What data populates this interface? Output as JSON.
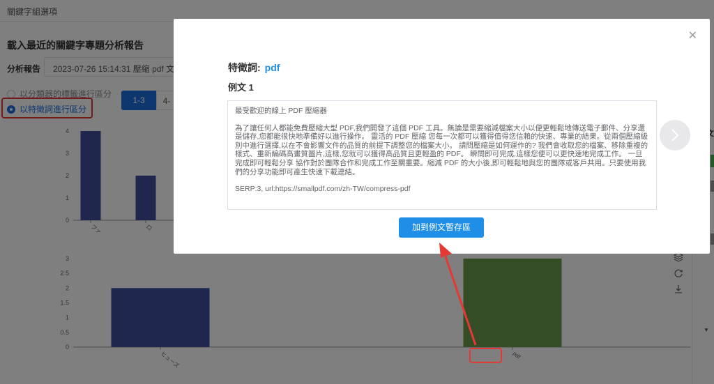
{
  "page": {
    "top_title": "關鍵字組選項",
    "report_title": "載入最近的關鍵字專題分析報告",
    "report_label": "分析報告",
    "report_value": "2023-07-26 15:14:31 壓縮 pdf 文",
    "radio_options": [
      "以分類器的標籤進行區分",
      "以特徵詞進行區分"
    ],
    "selected_radio": 1,
    "segment_buttons": [
      "1-3",
      "4-"
    ],
    "right_strip_text": "文"
  },
  "chart_data": [
    {
      "type": "bar",
      "ylim": [
        0,
        4
      ],
      "yticks": [
        "0",
        "1",
        "2",
        "3",
        "4"
      ],
      "categories": [
        "ファ",
        "ロ"
      ],
      "values": [
        4,
        2
      ],
      "colors": [
        "#3f4f9c",
        "#3f4f9c"
      ]
    },
    {
      "type": "bar",
      "ylim": [
        0,
        3
      ],
      "yticks": [
        "0",
        "0.5",
        "1",
        "1.5",
        "2",
        "2.5",
        "3"
      ],
      "categories": [
        "ヒューズ",
        "pdf"
      ],
      "values": [
        2,
        3
      ],
      "colors": [
        "#3f4f9c",
        "#6a9a4e"
      ]
    }
  ],
  "modal": {
    "feature_label": "特徵詞:",
    "feature_keyword": "pdf",
    "example_title": "例文 1",
    "example_paragraphs": [
      "最受歡迎的線上 PDF 壓縮器",
      "為了讓任何人都能免費壓縮大型 PDF,我們開發了這個 PDF 工具。無論是需要縮減檔案大小以便更輕鬆地傳送電子郵件、分享還是儲存,您都能很快地準備好以進行操作。 靈活的 PDF 壓縮 您每一次都可以獲得值得您信賴的快速、專業的結果。從兩個壓縮級別中進行選擇,以在不會影響文件的品質的前提下調整您的檔案大小。 請問壓縮是如何運作的? 我們會收取您的檔案、移除重複的樣式、重新編碼高畫質圖片,這樣,您就可以獲得高品質且更輕盈的 PDF。 瞬間即可完成,這樣您便可以更快速地完成工作。 一旦完成即可輕鬆分享 協作對於團隊合作和完成工作至關重要。縮減 PDF 的大小後,即可輕鬆地與您的團隊或客戶共用。只要使用我們的分享功能即可產生快速下載連結。",
      "SERP:3, url:https://smallpdf.com/zh-TW/compress-pdf"
    ],
    "add_button": "加到例文暫存區"
  },
  "icons": {
    "close": "close-icon",
    "next": "chevron-right-icon",
    "side": [
      "layers-icon",
      "refresh-icon",
      "download-icon"
    ]
  }
}
